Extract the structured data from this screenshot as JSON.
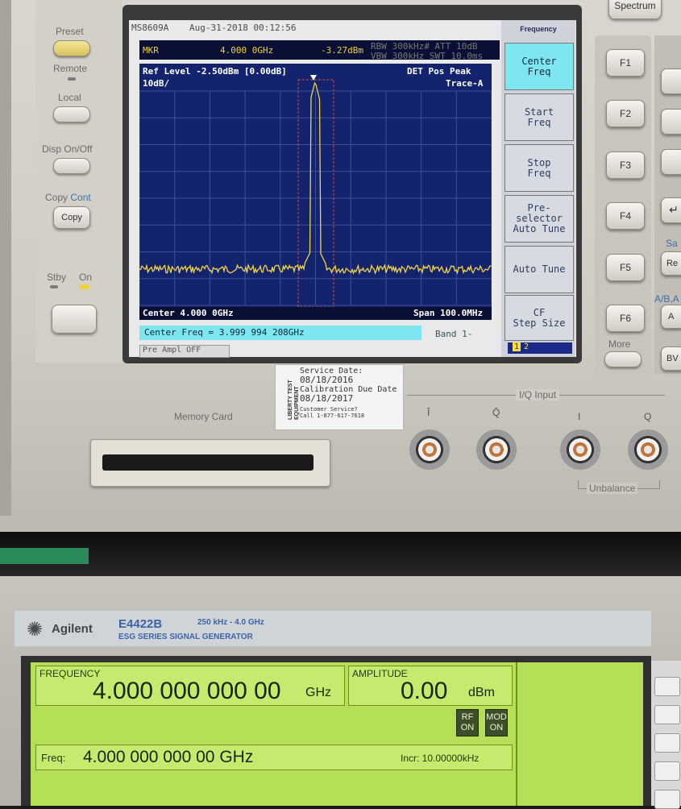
{
  "analyzer": {
    "panel": {
      "preset": "Preset",
      "remote": "Remote",
      "local": "Local",
      "disp": "Disp",
      "on_off": "On/Off",
      "copy_lbl": "Copy",
      "cont": "Cont",
      "copy_btn": "Copy",
      "stby": "Stby",
      "on": "On",
      "spectrum_btn": "Spectrum"
    },
    "screen": {
      "model": "MS8609A",
      "datetime": "Aug-31-2018 00:12:56",
      "mkr": "MKR",
      "mkr_freq": "4.000 0GHz",
      "mkr_level": "-3.27dBm",
      "rbw_line1": "RBW 300kHz# ATT 10dB",
      "rbw_line2": "VBW 300kHz  SWT 10.0ms",
      "ref_level": "Ref Level -2.50dBm [0.00dB]",
      "scale": "10dB/",
      "det": "DET   Pos Peak",
      "trace": "Trace-A",
      "center": "Center 4.000 0GHz",
      "span": "Span 100.0MHz",
      "cf_entry": "Center Freq = 3.999 994 208GHz",
      "band": "Band 1-",
      "preamp": "Pre Ampl OFF",
      "page_1": "1",
      "page_2": "2"
    },
    "softkeys": {
      "header": "Frequency",
      "items": [
        {
          "label": "Center\nFreq",
          "active": true
        },
        {
          "label": "Start\nFreq",
          "active": false
        },
        {
          "label": "Stop\nFreq",
          "active": false
        },
        {
          "label": "Pre-\nselector\nAuto Tune",
          "active": false
        },
        {
          "label": "Auto Tune",
          "active": false
        },
        {
          "label": "CF\nStep Size",
          "active": false
        }
      ]
    },
    "fkeys": [
      "F1",
      "F2",
      "F3",
      "F4",
      "F5",
      "F6"
    ],
    "more": "More",
    "right_labels": {
      "sa": "Sa",
      "re": "Re",
      "ab": "A/B,A",
      "a": "A",
      "bv": "BV"
    },
    "memory_card": "Memory Card",
    "iq_input": "I/Q Input",
    "iq": [
      "Ī",
      "Q̄",
      "I",
      "Q"
    ],
    "unbalance": "Unbalance",
    "sticker": {
      "side": "LIBERTY TEST EQUIPMENT",
      "service_date_label": "Service Date:",
      "service_date": "08/18/2016",
      "due_label": "Calibration Due Date",
      "due_date": "08/18/2017",
      "cs_label": "Customer Service?",
      "cs_phone": "Call 1-877-617-7618"
    },
    "trace_color": "#f0d445",
    "plot_bg": "#14236e"
  },
  "siggen": {
    "brand": "Agilent",
    "logo_icon": "agilent-spark-icon",
    "model": "E4422B",
    "range": "250 kHz - 4.0 GHz",
    "series": "ESG SERIES SIGNAL GENERATOR",
    "freq_label": "FREQUENCY",
    "freq_value": "4.000 000 000 00",
    "freq_unit": "GHz",
    "amp_label": "AMPLITUDE",
    "amp_value": "0.00",
    "amp_unit": "dBm",
    "rf_on": "RF\nON",
    "mod_on": "MOD\nON",
    "entry_label": "Freq:",
    "entry_value": "4.000 000 000 00 GHz",
    "incr": "Incr: 10.00000kHz",
    "lcd_color": "#b6df58"
  }
}
